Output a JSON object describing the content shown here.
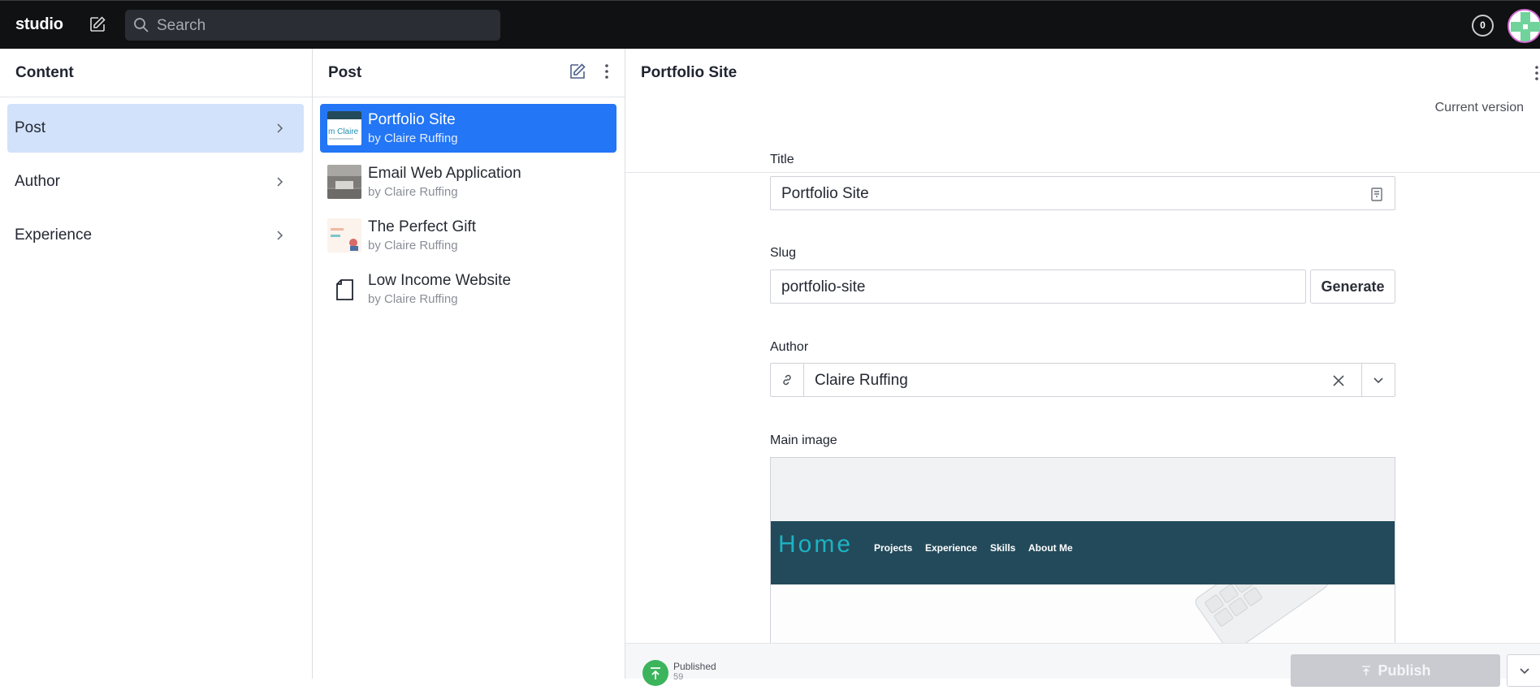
{
  "topbar": {
    "brand": "studio",
    "search_placeholder": "Search",
    "notification_count": "0"
  },
  "content_pane": {
    "title": "Content",
    "types": [
      {
        "label": "Post",
        "selected": true
      },
      {
        "label": "Author",
        "selected": false
      },
      {
        "label": "Experience",
        "selected": false
      }
    ]
  },
  "post_pane": {
    "title": "Post",
    "documents": [
      {
        "title": "Portfolio Site",
        "subtitle": "by Claire Ruffing",
        "selected": true,
        "thumb": "portfolio-thumb"
      },
      {
        "title": "Email Web Application",
        "subtitle": "by Claire Ruffing",
        "selected": false,
        "thumb": "email-thumb"
      },
      {
        "title": "The Perfect Gift",
        "subtitle": "by Claire Ruffing",
        "selected": false,
        "thumb": "gift-thumb"
      },
      {
        "title": "Low Income Website",
        "subtitle": "by Claire Ruffing",
        "selected": false,
        "thumb": "document-icon"
      }
    ]
  },
  "editor": {
    "doc_title": "Portfolio Site",
    "version_label": "Current version",
    "fields": {
      "title_label": "Title",
      "title_value": "Portfolio Site",
      "slug_label": "Slug",
      "slug_value": "portfolio-site",
      "generate_label": "Generate",
      "author_label": "Author",
      "author_value": "Claire Ruffing",
      "main_image_label": "Main image"
    },
    "preview": {
      "home": "Home",
      "nav": [
        "Projects",
        "Experience",
        "Skills",
        "About Me"
      ]
    },
    "footer": {
      "status": "Published",
      "status_sub": "59",
      "publish_label": "Publish"
    }
  },
  "colors": {
    "topbar": "#101112",
    "selected_type": "#d3e2fb",
    "selected_doc": "#2376f5",
    "published": "#3cb45c",
    "preview_band": "#234a5a",
    "preview_home": "#1cb3c3"
  }
}
